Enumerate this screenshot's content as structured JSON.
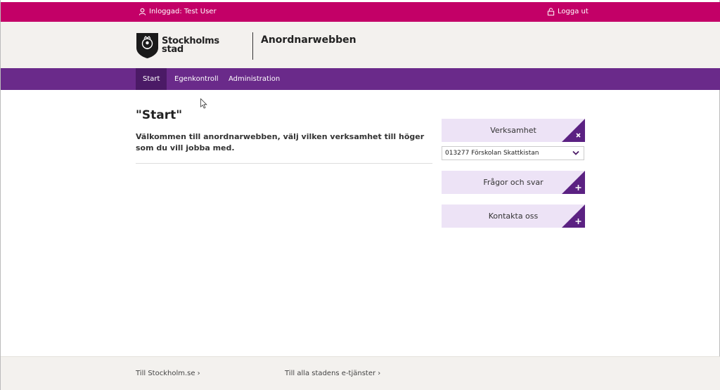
{
  "topbar": {
    "user_label": "Inloggad: Test User",
    "logout_label": "Logga ut",
    "user_icon": "user-icon",
    "lock_icon": "lock-icon"
  },
  "header": {
    "logo_line1": "Stockholms",
    "logo_line2": "stad",
    "app_name": "Anordnarwebben"
  },
  "nav": {
    "tabs": [
      {
        "label": "Start",
        "active": true
      },
      {
        "label": "Egenkontroll",
        "active": false
      },
      {
        "label": "Administration",
        "active": false
      }
    ]
  },
  "main": {
    "title": "\"Start\"",
    "intro": "Välkommen till anordnarwebben, välj vilken verksamhet till höger som du vill jobba med."
  },
  "sidebar": {
    "verksamhet_label": "Verksamhet",
    "selected_verksamhet": "013277 Förskolan Skattkistan",
    "faq_label": "Frågor och svar",
    "contact_label": "Kontakta oss"
  },
  "footer": {
    "link1": "Till Stockholm.se ›",
    "link2": "Till alla stadens e-tjänster ›"
  },
  "colors": {
    "topbar": "#c30067",
    "nav": "#6a2a8a",
    "nav_active": "#4b1a66",
    "sidebox": "#ede3f6",
    "corner": "#5b2182",
    "header_bg": "#f3f1ee"
  }
}
